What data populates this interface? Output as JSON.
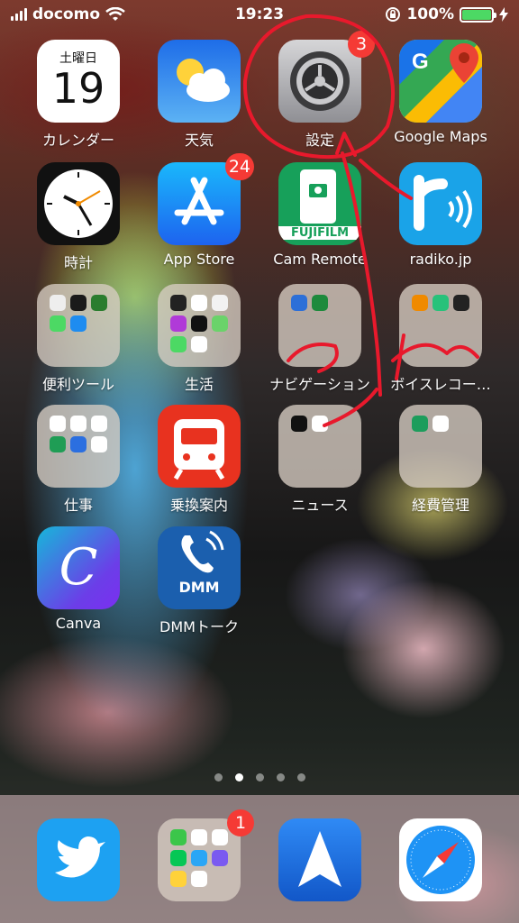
{
  "status_bar": {
    "carrier": "docomo",
    "time": "19:23",
    "battery": "100%"
  },
  "apps": {
    "calendar": {
      "label": "カレンダー",
      "weekday": "土曜日",
      "day": "19"
    },
    "weather": {
      "label": "天気"
    },
    "settings": {
      "label": "設定",
      "badge": "3"
    },
    "google_maps": {
      "label": "Google Maps"
    },
    "clock": {
      "label": "時計"
    },
    "app_store": {
      "label": "App Store",
      "badge": "24"
    },
    "cam_remote": {
      "label": "Cam Remote",
      "logo_text": "FUJIFILM"
    },
    "radiko": {
      "label": "radiko.jp"
    },
    "benri_tools": {
      "label": "便利ツール"
    },
    "seikatsu": {
      "label": "生活"
    },
    "navigation": {
      "label": "ナビゲーション"
    },
    "voice_recorder": {
      "label": "ボイスレコー…"
    },
    "shigoto": {
      "label": "仕事"
    },
    "transfer": {
      "label": "乗換案内"
    },
    "news": {
      "label": "ニュース"
    },
    "expenses": {
      "label": "経費管理"
    },
    "canva": {
      "label": "Canva",
      "logo_text": "C"
    },
    "dmm_talk": {
      "label": "DMMトーク",
      "logo_text": "DMM"
    }
  },
  "page_dots": {
    "count": 5,
    "active_index": 1
  },
  "dock": {
    "twitter": {
      "name": "Twitter"
    },
    "folder": {
      "badge": "1"
    },
    "spark": {
      "name": "Spark"
    },
    "safari": {
      "name": "Safari"
    }
  },
  "colors": {
    "badge": "#f53a35",
    "annotation": "#e8192c",
    "battery": "#4cd964"
  }
}
